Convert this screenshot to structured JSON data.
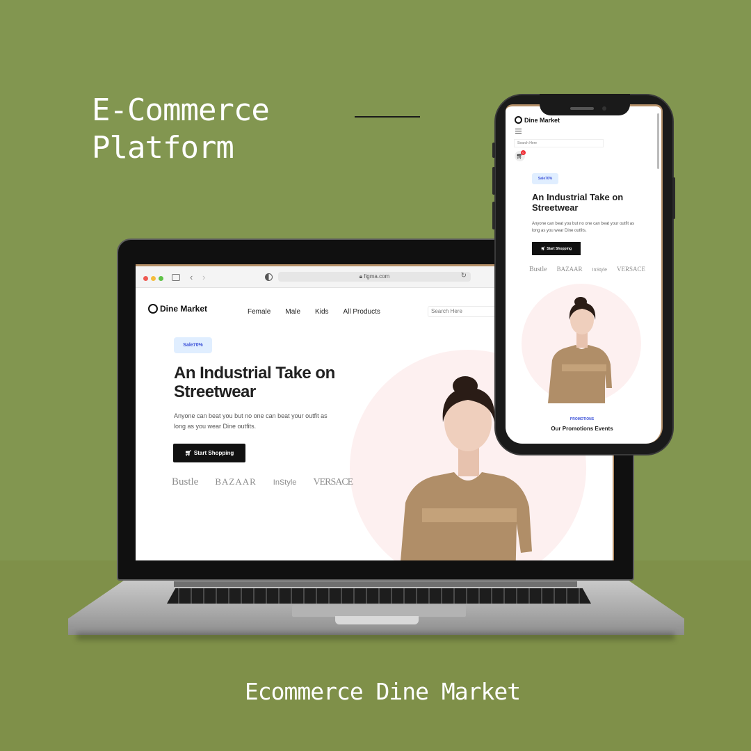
{
  "headline": {
    "line1": "E-Commerce",
    "line2": "Platform"
  },
  "footer_caption": "Ecommerce Dine Market",
  "laptop": {
    "browser": {
      "url": "figma.com"
    },
    "site": {
      "logo": "Dine Market",
      "nav": [
        "Female",
        "Male",
        "Kids",
        "All Products"
      ],
      "search_placeholder": "Search Here",
      "sale_badge": "Sale70%",
      "hero_title": "An Industrial Take on Streetwear",
      "hero_subtitle": "Anyone can beat you but no one can beat your outfit as long as you wear Dine outfits.",
      "cta_label": "Start Shopping",
      "brands": [
        "Bustle",
        "BAZAAR",
        "InStyle",
        "VERSACE"
      ]
    }
  },
  "phone": {
    "logo": "Dine Market",
    "search_placeholder": "Search Here",
    "cart_count": "0",
    "sale_badge": "Sale70%",
    "hero_title": "An Industrial Take on Streetwear",
    "hero_subtitle": "Anyone can beat you but no one can beat your outfit as long as you wear Dine outfits.",
    "cta_label": "Start Shopping",
    "brands": [
      "Bustle",
      "BAZAAR",
      "InStyle",
      "VERSACE"
    ],
    "promo_label": "PROMOTIONS",
    "promo_title": "Our Promotions Events"
  },
  "colors": {
    "background": "#829650",
    "accent_blue": "#3a50d8",
    "sale_bg": "#e0eeff",
    "hero_circle": "#fdf0f0"
  },
  "icons": [
    "shopping-cart-icon",
    "menu-icon",
    "sidebar-icon",
    "lock-icon",
    "reload-icon"
  ]
}
